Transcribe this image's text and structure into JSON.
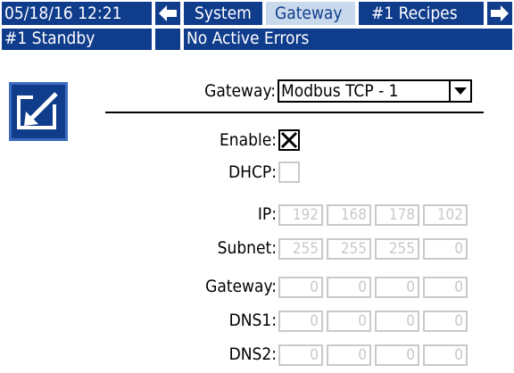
{
  "header": {
    "datetime": "05/18/16 12:21",
    "tabs": [
      {
        "label": "System"
      },
      {
        "label": "Gateway",
        "active": true
      },
      {
        "label": "#1 Recipes"
      }
    ]
  },
  "status": {
    "mode": "#1 Standby",
    "errors": "No Active Errors"
  },
  "form": {
    "gateway_label": "Gateway:",
    "gateway_value": "Modbus TCP - 1",
    "enable_label": "Enable:",
    "enable_checked": true,
    "dhcp_label": "DHCP:",
    "dhcp_checked": false,
    "rows": [
      {
        "label": "IP:",
        "octets": [
          "192",
          "168",
          "178",
          "102"
        ]
      },
      {
        "label": "Subnet:",
        "octets": [
          "255",
          "255",
          "255",
          "0"
        ]
      },
      {
        "label": "Gateway:",
        "octets": [
          "0",
          "0",
          "0",
          "0"
        ]
      },
      {
        "label": "DNS1:",
        "octets": [
          "0",
          "0",
          "0",
          "0"
        ]
      },
      {
        "label": "DNS2:",
        "octets": [
          "0",
          "0",
          "0",
          "0"
        ]
      }
    ]
  },
  "colors": {
    "bar_blue": "#103c8c",
    "active_tab": "#c9d9ec",
    "disabled_field": "#c9c9c9"
  },
  "icons": {
    "edit": "edit-screen-icon",
    "left": "arrow-left-icon",
    "right": "arrow-right-icon"
  }
}
